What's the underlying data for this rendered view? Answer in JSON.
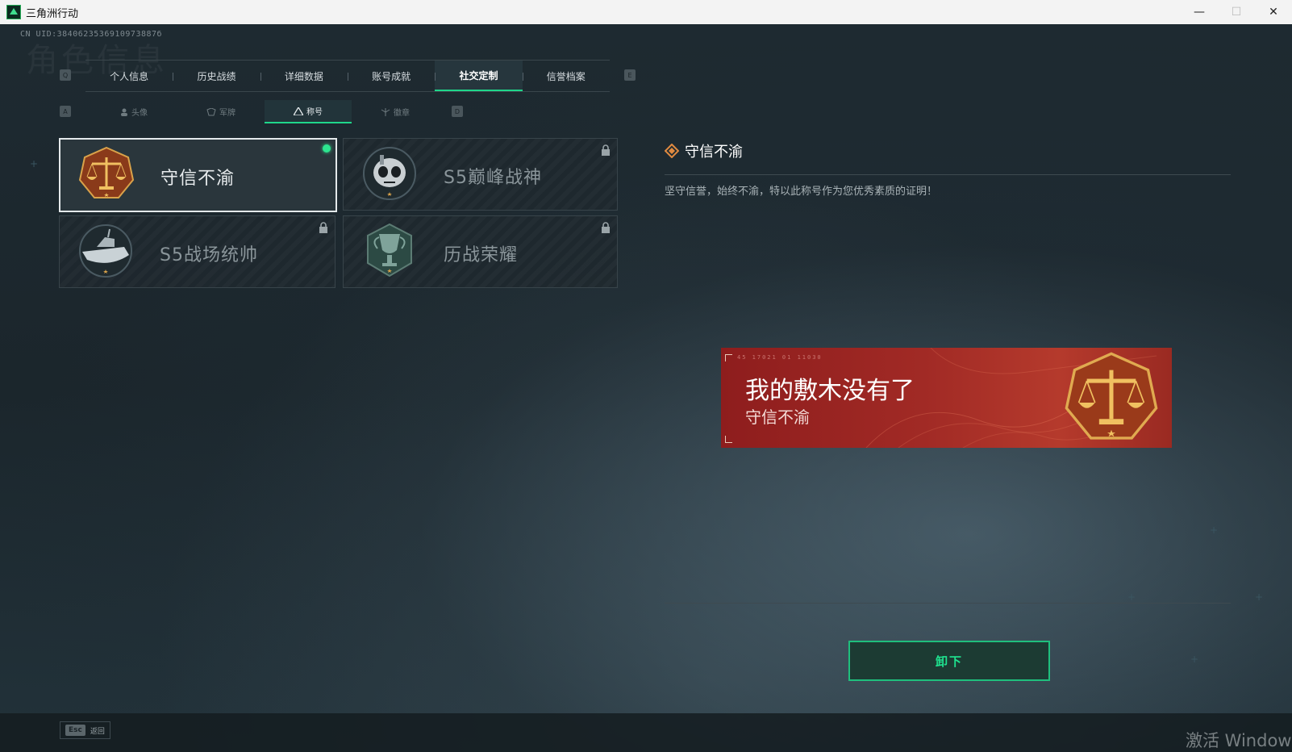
{
  "window": {
    "title": "三角洲行动",
    "minimize": "—",
    "maximize": "☐",
    "close": "✕"
  },
  "header": {
    "uid": "CN UID:3840623536910973887б",
    "ghost_title": "角色信息"
  },
  "tabs": {
    "left_key": "Q",
    "right_key": "E",
    "items": [
      {
        "label": "个人信息"
      },
      {
        "label": "历史战绩"
      },
      {
        "label": "详细数据"
      },
      {
        "label": "账号成就"
      },
      {
        "label": "社交定制",
        "active": true
      },
      {
        "label": "信誉档案"
      }
    ]
  },
  "subtabs": {
    "left_key": "A",
    "right_key": "D",
    "items": [
      {
        "label": "头像",
        "icon": "person-icon"
      },
      {
        "label": "军牌",
        "icon": "dogtag-icon"
      },
      {
        "label": "称号",
        "icon": "title-icon",
        "active": true
      },
      {
        "label": "徽章",
        "icon": "badge-icon"
      }
    ]
  },
  "titles": [
    {
      "name": "守信不渝",
      "emblem": "scales-emblem",
      "selected": true,
      "equipped": true
    },
    {
      "name": "S5巅峰战神",
      "emblem": "skull-emblem",
      "locked": true
    },
    {
      "name": "S5战场统帅",
      "emblem": "boat-emblem",
      "locked": true
    },
    {
      "name": "历战荣耀",
      "emblem": "trophy-emblem",
      "locked": true
    }
  ],
  "detail": {
    "title": "守信不渝",
    "description": "坚守信誉，始终不渝，特以此称号作为您优秀素质的证明！"
  },
  "banner": {
    "code": "45 17021 01 11030",
    "player_name": "我的敷木没有了",
    "title": "守信不渝"
  },
  "actions": {
    "unequip": "卸下",
    "esc_key": "Esc",
    "esc_label": "返回"
  },
  "watermark": "激活 Windows",
  "colors": {
    "accent": "#1fd68a",
    "banner": "#a12a25",
    "emblem_gold": "#d9a24a"
  }
}
